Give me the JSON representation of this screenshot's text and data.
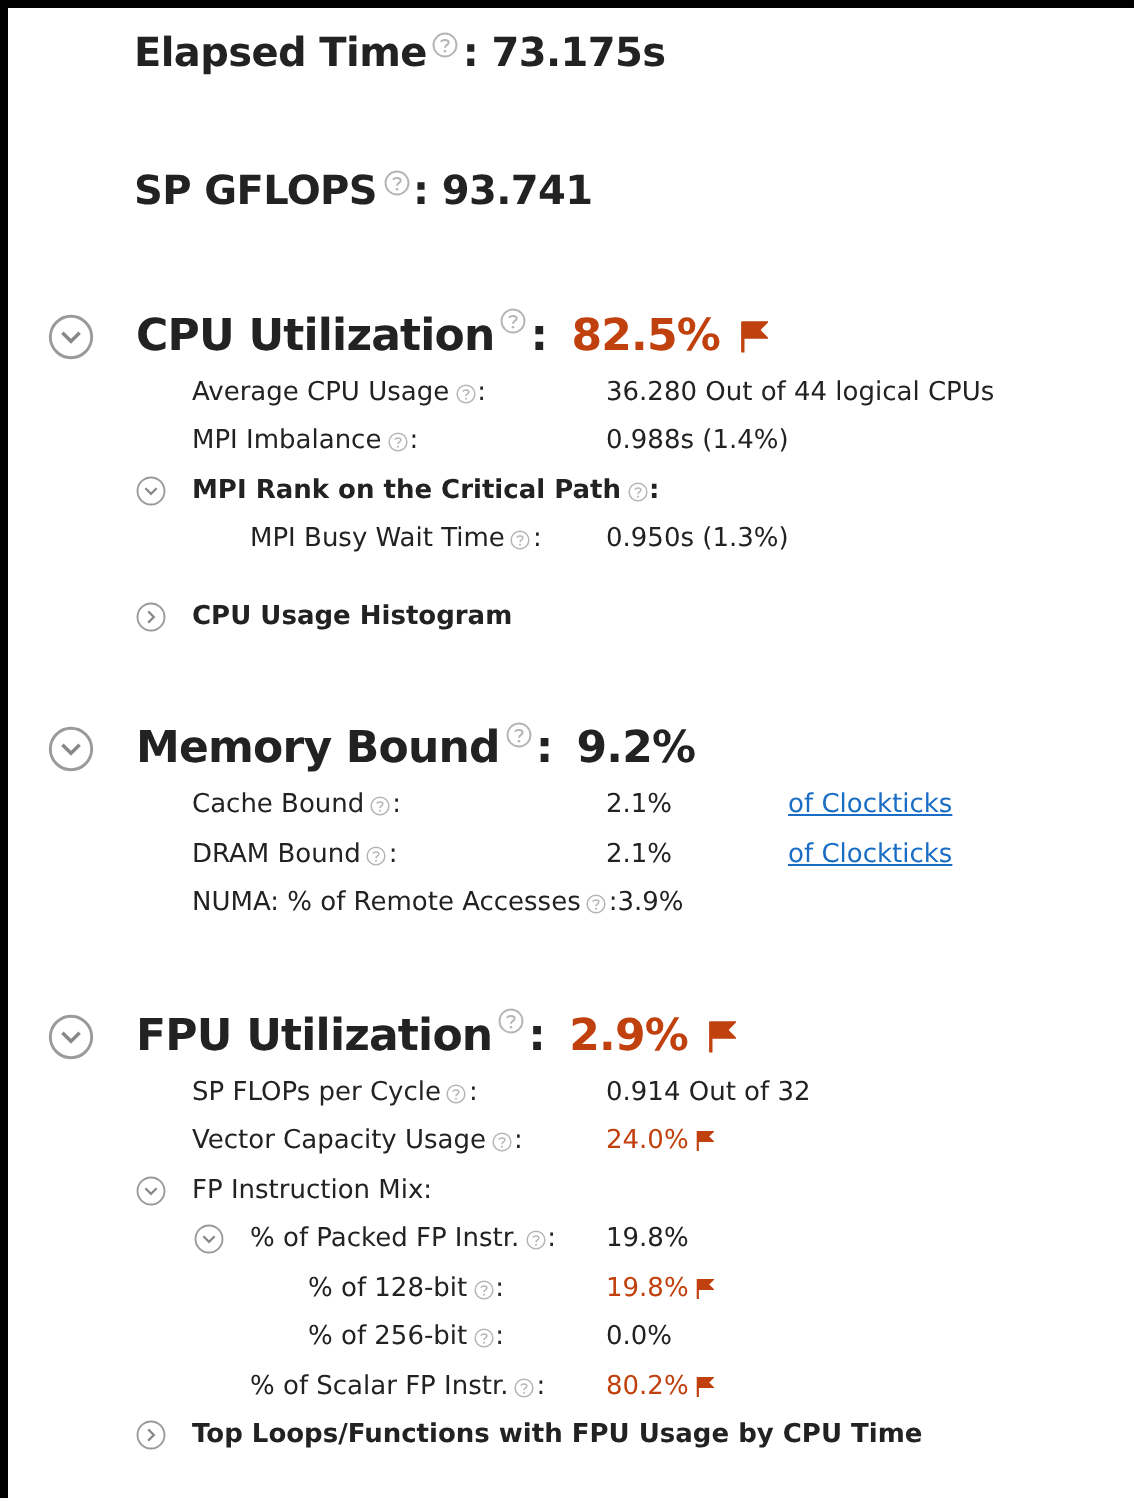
{
  "top_metrics": [
    {
      "label": "Elapsed Time",
      "help": true,
      "colon": ":",
      "value": "73.175s"
    },
    {
      "label": "SP GFLOPS",
      "help": true,
      "colon": ":",
      "value": "93.741"
    }
  ],
  "sections": [
    {
      "title": "CPU Utilization",
      "help": true,
      "colon": ":",
      "value": "82.5%",
      "flagged": true,
      "expanded": true,
      "rows": [
        {
          "kind": "metric",
          "label": "Average CPU Usage",
          "help": true,
          "colon": ":",
          "value": "36.280 Out of 44 logical CPUs",
          "flagged": false
        },
        {
          "kind": "metric",
          "label": "MPI Imbalance",
          "help": true,
          "colon": ":",
          "value": "0.988s (1.4%)",
          "flagged": false
        },
        {
          "kind": "heading",
          "label": "MPI Rank on the Critical Path",
          "help": true,
          "colon": ":",
          "expanded": true,
          "children": [
            {
              "kind": "metric",
              "label": "MPI Busy Wait Time",
              "help": true,
              "colon": ":",
              "value": "0.950s (1.3%)",
              "flagged": false
            }
          ]
        },
        {
          "kind": "heading",
          "label": "CPU Usage Histogram",
          "expanded": false
        }
      ]
    },
    {
      "title": "Memory Bound",
      "help": true,
      "colon": ":",
      "value": "9.2%",
      "flagged": false,
      "expanded": true,
      "rows": [
        {
          "kind": "metric",
          "label": "Cache Bound",
          "help": true,
          "colon": ":",
          "value": "2.1%",
          "flagged": false,
          "link": "of Clockticks"
        },
        {
          "kind": "metric",
          "label": "DRAM Bound",
          "help": true,
          "colon": ":",
          "value": "2.1%",
          "flagged": false,
          "link": "of Clockticks"
        },
        {
          "kind": "metric",
          "label": "NUMA: % of Remote Accesses",
          "help": true,
          "colon": ":",
          "value": "3.9%",
          "flagged": false
        }
      ]
    },
    {
      "title": "FPU Utilization",
      "help": true,
      "colon": ":",
      "value": "2.9%",
      "flagged": true,
      "expanded": true,
      "rows": [
        {
          "kind": "metric",
          "label": "SP FLOPs per Cycle",
          "help": true,
          "colon": ":",
          "value": "0.914 Out of 32",
          "flagged": false
        },
        {
          "kind": "metric",
          "label": "Vector Capacity Usage",
          "help": true,
          "colon": ":",
          "value": "24.0%",
          "flagged": true
        },
        {
          "kind": "metric",
          "label": "FP Instruction Mix:",
          "expanded": true,
          "children": [
            {
              "kind": "metric",
              "label": "% of Packed FP Instr.",
              "help": true,
              "colon": ":",
              "value": "19.8%",
              "flagged": false,
              "expanded": true,
              "children": [
                {
                  "kind": "metric",
                  "label": "% of 128-bit",
                  "help": true,
                  "colon": ":",
                  "value": "19.8%",
                  "flagged": true
                },
                {
                  "kind": "metric",
                  "label": "% of 256-bit",
                  "help": true,
                  "colon": ":",
                  "value": "0.0%",
                  "flagged": false
                }
              ]
            },
            {
              "kind": "metric",
              "label": "% of Scalar FP Instr.",
              "help": true,
              "colon": ":",
              "value": "80.2%",
              "flagged": true
            }
          ]
        },
        {
          "kind": "heading",
          "label": "Top Loops/Functions with FPU Usage by CPU Time",
          "expanded": false
        }
      ]
    }
  ]
}
